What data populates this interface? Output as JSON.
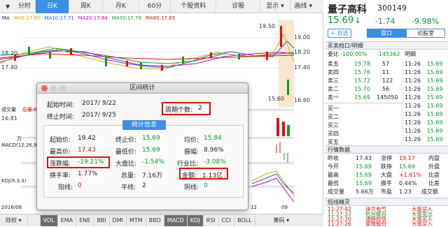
{
  "toolbar": {
    "time_label": "分时",
    "day_k": "日K",
    "week_k": "周K",
    "month_k": "月K",
    "min60": "60分",
    "info": "个股资料",
    "diag": "诊股",
    "display": "显示",
    "drawline": "画线"
  },
  "chart": {
    "ma_legend": {
      "ma": "MA",
      "ma5": "MA5:17.85",
      "ma10": "MA10:17.71",
      "ma20": "MA20:17.64",
      "ma30": "MA30:17.79",
      "ma60": "MA60:17.83"
    },
    "y_ticks": [
      "19.00",
      "18.20",
      "17.40",
      "16.60",
      "16.81"
    ],
    "high_label": "19.50",
    "low_label": "15.60",
    "vol_title": "成交量",
    "vol_value": "总量:6",
    "wan": "万",
    "macd_title": "MACD(12,26,9)",
    "kdj_title": "KDJ(9,3,3)",
    "date_left": "2016/08",
    "date_mid": "12",
    "date_right": "09",
    "colors": {
      "ma5": "#e6a200",
      "ma10": "#1a5bd0",
      "ma20": "#c000c0",
      "ma30": "#0a9a2a",
      "ma60": "#e01010"
    }
  },
  "bottom": {
    "rights": "除权",
    "tabs": [
      "VOL",
      "EMA",
      "ENE",
      "BBI",
      "DMI",
      "MTM",
      "BBD",
      "MACD",
      "KDJ",
      "RSI",
      "CCI",
      "BOLL"
    ],
    "formula": "筹码"
  },
  "dialog": {
    "title": "区间统计",
    "start_label": "起始时间:",
    "start_val": "2017/ 9/22",
    "end_label": "终止时间:",
    "end_val": "2017/ 9/25",
    "period_label": "周期个数:",
    "period_val": "2",
    "stats_btn": "统计信息",
    "open_label": "起始价:",
    "open_val": "19.42",
    "close_label": "终止价:",
    "close_val": "15.69",
    "avg_label": "均价:",
    "avg_val": "15.84",
    "high_label": "最高价:",
    "high_val": "17.43",
    "low_label": "最低价:",
    "low_val": "15.69",
    "amp_label": "振幅:",
    "amp_val": "8.96%",
    "chg_label": "涨跌幅:",
    "chg_val": "-19.21%",
    "mkt_label": "大盘比:",
    "mkt_val": "-1.54%",
    "ind_label": "行业比:",
    "ind_val": "-3.08%",
    "turn_label": "换手率:",
    "turn_val": "1.77%",
    "vol_label": "总量:",
    "vol_val": "7.16万",
    "amt_label": "金额:",
    "amt_val": "1.13亿",
    "up_label": "阳线:",
    "up_val": "0",
    "flat_label": "平线:",
    "flat_val": "2",
    "down_label": "阴线:",
    "down_val": "0"
  },
  "panel": {
    "name": "量子高科",
    "code": "300149",
    "price": "15.69",
    "arrow": "↓",
    "change": "-1.74",
    "pct": "-9.98%",
    "add_btn": "+ 自选",
    "tab_pankou": "盘口",
    "tab_forum": "论股堂",
    "book_title": "买卖档口/明细",
    "weibi_label": "委比",
    "weibi_val": "-100.00%",
    "weicha_val": "-145362",
    "mingxi": "明细",
    "asks": [
      [
        "卖五",
        "15.78",
        "57"
      ],
      [
        "卖四",
        "15.76",
        "11"
      ],
      [
        "卖三",
        "15.72",
        "122"
      ],
      [
        "卖二",
        "15.70",
        "56"
      ],
      [
        "卖一",
        "15.69",
        "145050"
      ]
    ],
    "bids": [
      "买一",
      "买二",
      "买三",
      "买四",
      "买五"
    ],
    "ticks": [
      [
        "11:26",
        "15.69"
      ],
      [
        "11:26",
        "15.69"
      ],
      [
        "11:26",
        "15.69"
      ],
      [
        "11:26",
        "15.69"
      ],
      [
        "11:26",
        "15.69"
      ],
      [
        "11:26",
        "15.69"
      ],
      [
        "11:26",
        "15.69"
      ],
      [
        "11:26",
        "15.69"
      ],
      [
        "11:26",
        "15.69"
      ],
      [
        "11:26",
        "15.69"
      ]
    ],
    "quote_title": "行情数据",
    "quote": [
      [
        "昨收",
        "17.43",
        "涨停",
        "19.17",
        "内盘"
      ],
      [
        "今开",
        "15.69",
        "跌停",
        "15.69",
        "外盘"
      ],
      [
        "最高",
        "15.69",
        "大盘",
        "+1.61%",
        "比盘"
      ],
      [
        "最低",
        "15.69",
        "换手",
        "0.44%",
        "比差"
      ],
      [
        "成交量",
        "5.66万",
        "市盈",
        "1.23",
        "成交额"
      ]
    ],
    "sprite_title": "短线精灵",
    "sprites": [
      [
        "11:27:42",
        "迪贝电气",
        "大笔买入"
      ],
      [
        "11:27:33",
        "杭州解百",
        "大笔卖出"
      ],
      [
        "11:27:30",
        "通鼎视信",
        "大笔买入"
      ],
      [
        "11:27:26",
        "翠微股份",
        "大笔买入"
      ]
    ]
  }
}
